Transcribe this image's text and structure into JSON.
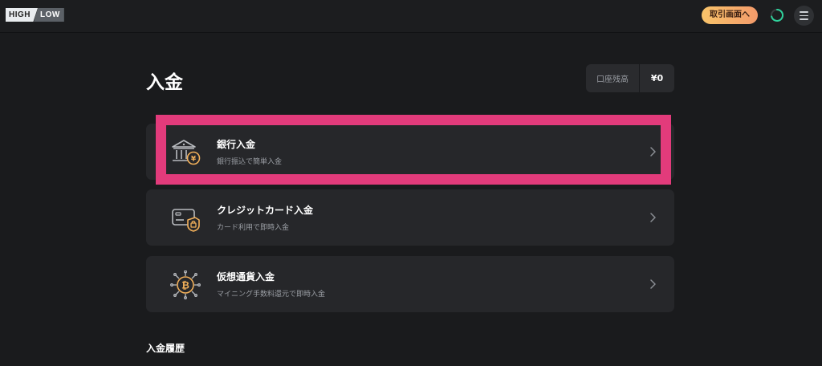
{
  "header": {
    "logo": {
      "high": "HIGH",
      "low": "LOW"
    },
    "trade_button": "取引画面へ"
  },
  "page": {
    "title": "入金",
    "balance": {
      "label": "口座残高",
      "value": "¥0"
    }
  },
  "deposit_methods": [
    {
      "title": "銀行入金",
      "subtitle": "銀行振込で簡単入金",
      "icon": "bank-yen-icon"
    },
    {
      "title": "クレジットカード入金",
      "subtitle": "カード利用で即時入金",
      "icon": "credit-card-lock-icon"
    },
    {
      "title": "仮想通貨入金",
      "subtitle": "マイニング手数料還元で即時入金",
      "icon": "bitcoin-network-icon"
    }
  ],
  "history": {
    "title": "入金履歴"
  },
  "colors": {
    "background": "#1a1b1d",
    "card": "#26272a",
    "highlight": "#e23b7b",
    "accent": "#f2b05a"
  }
}
